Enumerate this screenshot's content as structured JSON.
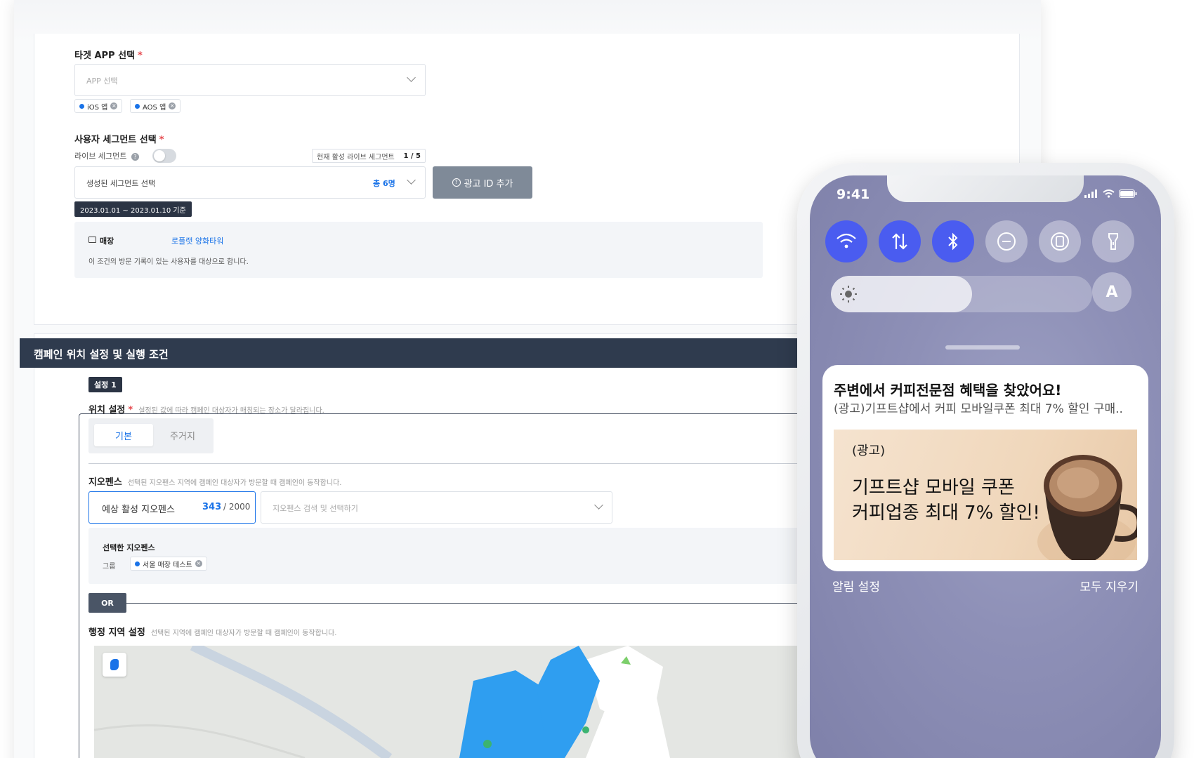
{
  "target_app": {
    "label": "타겟 APP 선택",
    "required_mark": "*",
    "placeholder": "APP 선택",
    "chips": [
      "iOS 앱",
      "AOS 앱"
    ]
  },
  "segment": {
    "label": "사용자 세그먼트 선택",
    "required_mark": "*",
    "live_label": "라이브 세그먼트",
    "live_counter_label": "현재 활성 라이브 세그먼트",
    "live_counter_value": "1 / 5",
    "select_placeholder": "생성된 세그먼트 선택",
    "total": "총 6명",
    "add_ad_id_button": "광고 ID 추가",
    "date_tag": "2023.01.01 ~ 2023.01.10 기준",
    "store_label": "매장",
    "store_value": "로플랫 양화타워",
    "store_desc": "이 조건의 방문 기록이 있는 사용자를 대상으로 합니다."
  },
  "campaign": {
    "header": "캠페인 위치 설정 및 실행 조건",
    "setting_tag": "설정 1",
    "location_label": "위치 설정",
    "location_hint": "설정된 값에 따라 캠페인 대상자가 매칭되는 장소가 달라집니다.",
    "location_options": [
      "기본",
      "주거지"
    ],
    "geofence_label": "지오펜스",
    "geofence_hint": "선택된 지오펜스 지역에 캠페인 대상자가 방문할 때 캠페인이 동작합니다.",
    "geofence_count_label": "예상 활성 지오펜스",
    "geofence_count": "343",
    "geofence_max": "/ 2000",
    "geofence_search_placeholder": "지오펜스 검색 및 선택하기",
    "selected_geofence_label": "선택한 지오펜스",
    "group_label": "그룹",
    "group_chip": "서울 매장 테스트",
    "or_tag": "OR",
    "admin_region_label": "행정 지역 설정",
    "admin_region_hint": "선택된 지역에 캠페인 대상자가 방문할 때 캠페인이 동작합니다."
  },
  "phone": {
    "time": "9:41",
    "controls": [
      {
        "icon": "wifi-icon",
        "on": true
      },
      {
        "icon": "data-transfer-icon",
        "on": true
      },
      {
        "icon": "bluetooth-icon",
        "on": true
      },
      {
        "icon": "do-not-disturb-icon",
        "on": false
      },
      {
        "icon": "rotation-lock-icon",
        "on": false
      },
      {
        "icon": "flashlight-icon",
        "on": false
      }
    ],
    "brightness_level": 0.54,
    "auto_brightness_label": "A",
    "notification": {
      "title": "주변에서 커피전문점 혜택을 찾았어요!",
      "body": "(광고)기프트샵에서 커피 모바일쿠폰 최대 7% 할인 구매..",
      "image_tag": "(광고)",
      "image_line1": "기프트샵 모바일 쿠폰",
      "image_line2": "커피업종 최대 7% 할인!"
    },
    "notif_settings": "알림 설정",
    "clear_all": "모두 지우기"
  },
  "colors": {
    "accent_blue": "#1a73e8",
    "header_navy": "#2f3b4e",
    "control_on": "#4a5cf0",
    "phone_bg": "#8e90b7"
  }
}
